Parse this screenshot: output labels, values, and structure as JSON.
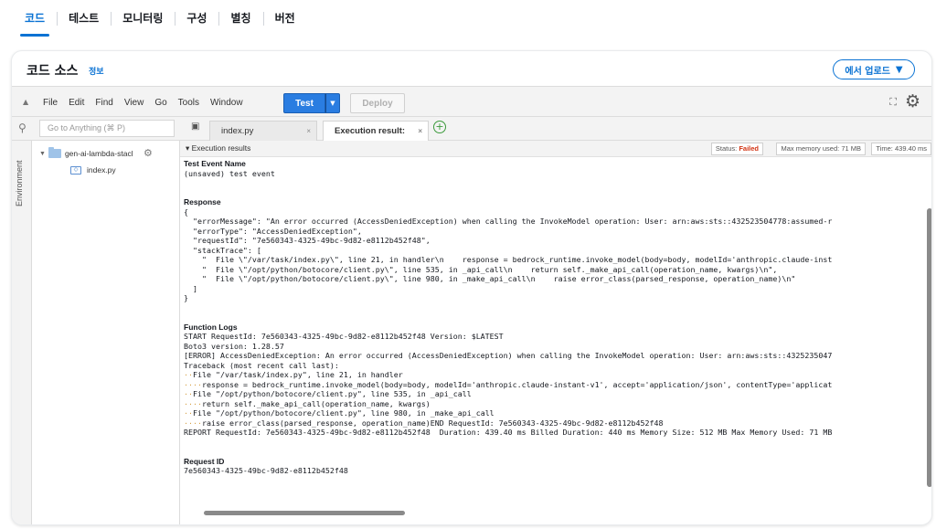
{
  "top_tabs": [
    "코드",
    "테스트",
    "모니터링",
    "구성",
    "별칭",
    "버전"
  ],
  "card": {
    "title": "코드 소스",
    "info": "정보",
    "upload_label": "에서 업로드"
  },
  "menu": [
    "File",
    "Edit",
    "Find",
    "View",
    "Go",
    "Tools",
    "Window"
  ],
  "toolbar": {
    "test_label": "Test",
    "deploy_label": "Deploy"
  },
  "search": {
    "placeholder": "Go to Anything (⌘ P)"
  },
  "environment_label": "Environment",
  "tree": {
    "folder": "gen-ai-lambda-stacl",
    "file": "index.py"
  },
  "editor_tabs": [
    {
      "label": "index.py"
    },
    {
      "label": "Execution result:"
    }
  ],
  "results": {
    "title": "Execution results",
    "status_label": "Status:",
    "status_value": "Failed",
    "memory": "Max memory used: 71 MB",
    "time": "Time: 439.40 ms",
    "test_event_heading": "Test Event Name",
    "test_event_value": "(unsaved) test event",
    "response_heading": "Response",
    "response_lines": [
      "{",
      "  \"errorMessage\": \"An error occurred (AccessDeniedException) when calling the InvokeModel operation: User: arn:aws:sts::432523504778:assumed-r",
      "  \"errorType\": \"AccessDeniedException\",",
      "  \"requestId\": \"7e560343-4325-49bc-9d82-e8112b452f48\",",
      "  \"stackTrace\": [",
      "    \"  File \\\"/var/task/index.py\\\", line 21, in handler\\n    response = bedrock_runtime.invoke_model(body=body, modelId='anthropic.claude-inst",
      "    \"  File \\\"/opt/python/botocore/client.py\\\", line 535, in _api_call\\n    return self._make_api_call(operation_name, kwargs)\\n\",",
      "    \"  File \\\"/opt/python/botocore/client.py\\\", line 980, in _make_api_call\\n    raise error_class(parsed_response, operation_name)\\n\"",
      "  ]",
      "}"
    ],
    "logs_heading": "Function Logs",
    "log_lines": [
      {
        "dots": "",
        "text": "START RequestId: 7e560343-4325-49bc-9d82-e8112b452f48 Version: $LATEST"
      },
      {
        "dots": "",
        "text": "Boto3 version: 1.28.57"
      },
      {
        "dots": "",
        "text": "[ERROR] AccessDeniedException: An error occurred (AccessDeniedException) when calling the InvokeModel operation: User: arn:aws:sts::4325235047"
      },
      {
        "dots": "",
        "text": "Traceback (most recent call last):"
      },
      {
        "dots": "··",
        "text": "File \"/var/task/index.py\", line 21, in handler"
      },
      {
        "dots": "····",
        "text": "response = bedrock_runtime.invoke_model(body=body, modelId='anthropic.claude-instant-v1', accept='application/json', contentType='applicat"
      },
      {
        "dots": "··",
        "text": "File \"/opt/python/botocore/client.py\", line 535, in _api_call"
      },
      {
        "dots": "····",
        "text": "return self._make_api_call(operation_name, kwargs)"
      },
      {
        "dots": "··",
        "text": "File \"/opt/python/botocore/client.py\", line 980, in _make_api_call"
      },
      {
        "dots": "····",
        "text": "raise error_class(parsed_response, operation_name)END RequestId: 7e560343-4325-49bc-9d82-e8112b452f48"
      },
      {
        "dots": "",
        "text": "REPORT RequestId: 7e560343-4325-49bc-9d82-e8112b452f48  Duration: 439.40 ms Billed Duration: 440 ms Memory Size: 512 MB Max Memory Used: 71 MB"
      }
    ],
    "request_id_heading": "Request ID",
    "request_id_value": "7e560343-4325-49bc-9d82-e8112b452f48"
  },
  "colors": {
    "accent": "#0972d3",
    "test_button": "#2a7de1",
    "failed": "#d13212"
  }
}
